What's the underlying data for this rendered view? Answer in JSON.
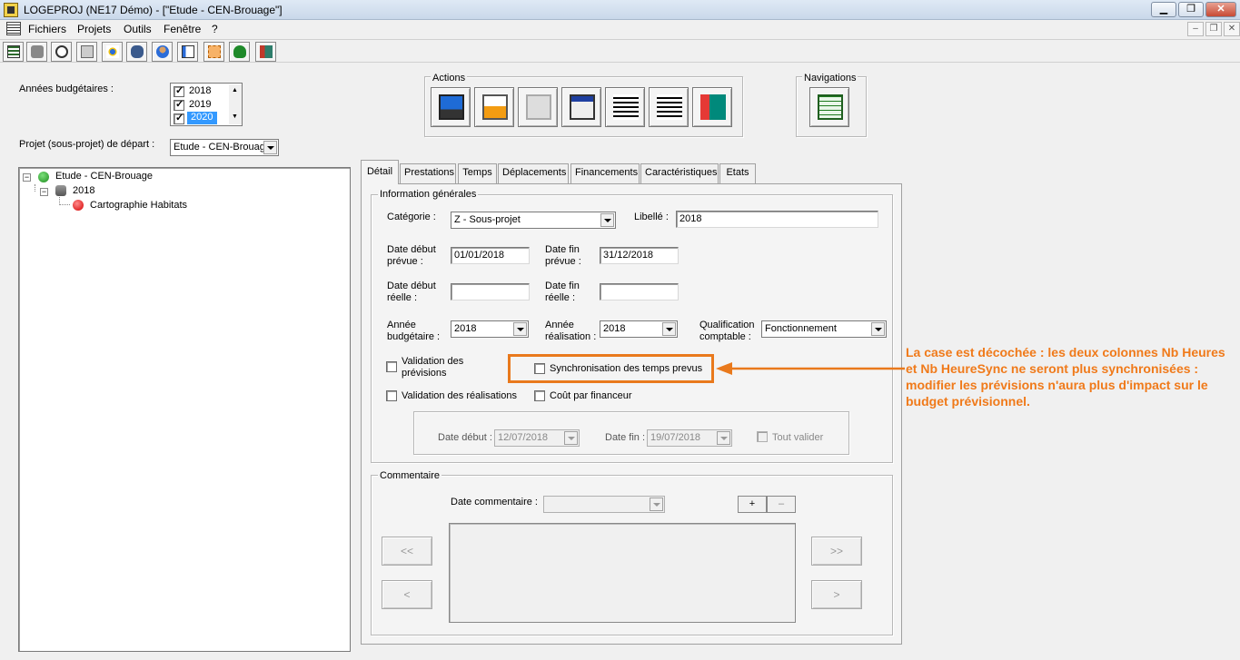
{
  "window": {
    "title": "LOGEPROJ (NE17 Démo) - [\"Etude - CEN-Brouage\"]"
  },
  "menu": {
    "items": [
      "Fichiers",
      "Projets",
      "Outils",
      "Fenêtre",
      "?"
    ]
  },
  "budget_years": {
    "label": "Années budgétaires :",
    "items": [
      {
        "label": "2018",
        "checked": true
      },
      {
        "label": "2019",
        "checked": true
      },
      {
        "label": "2020",
        "checked": true,
        "selected": true
      }
    ]
  },
  "start_project": {
    "label": "Projet (sous-projet) de départ :",
    "value": "Etude - CEN-Brouag"
  },
  "tree": {
    "root": "Etude - CEN-Brouage",
    "year": "2018",
    "leaf": "Cartographie Habitats"
  },
  "actions": {
    "title": "Actions"
  },
  "navigations": {
    "title": "Navigations"
  },
  "tabs": [
    "Détail",
    "Prestations",
    "Temps",
    "Déplacements",
    "Financements",
    "Caractéristiques",
    "Etats"
  ],
  "info": {
    "title": "Information générales",
    "categorie_label": "Catégorie :",
    "categorie_value": "Z - Sous-projet",
    "libelle_label": "Libellé :",
    "libelle_value": "2018",
    "date_debut_prevue_label1": "Date début",
    "date_debut_prevue_label2": "prévue :",
    "date_debut_prevue_value": "01/01/2018",
    "date_fin_prevue_label1": "Date fin",
    "date_fin_prevue_label2": "prévue :",
    "date_fin_prevue_value": "31/12/2018",
    "date_debut_reelle_label1": "Date début",
    "date_debut_reelle_label2": "réelle :",
    "date_debut_reelle_value": "",
    "date_fin_reelle_label1": "Date fin",
    "date_fin_reelle_label2": "réelle :",
    "date_fin_reelle_value": "",
    "annee_budgetaire_label1": "Année",
    "annee_budgetaire_label2": "budgétaire :",
    "annee_budgetaire_value": "2018",
    "annee_realisation_label1": "Année",
    "annee_realisation_label2": "réalisation :",
    "annee_realisation_value": "2018",
    "qualification_label1": "Qualification",
    "qualification_label2": "comptable :",
    "qualification_value": "Fonctionnement",
    "validation_previsions_label1": "Validation des",
    "validation_previsions_label2": "prévisions",
    "synchronisation_label": "Synchronisation des temps prevus",
    "validation_realisations_label": "Validation des réalisations",
    "cout_financeur_label": "Coût par financeur",
    "date_debut_label": "Date début :",
    "date_debut_value": "12/07/2018",
    "date_fin_label": "Date fin :",
    "date_fin_value": "19/07/2018",
    "tout_valider_label": "Tout valider"
  },
  "comment": {
    "title": "Commentaire",
    "date_label": "Date commentaire :",
    "date_value": "",
    "plus": "+",
    "minus": "–",
    "first": "<<",
    "prev": "<",
    "last": ">>",
    "next": ">"
  },
  "annotation": {
    "text": "La case est décochée : les deux colonnes Nb Heures et Nb HeureSync ne seront plus synchronisées : modifier les prévisions n'aura plus d'impact sur le budget prévisionnel."
  },
  "colors": {
    "annotation": "#e9791c",
    "selection": "#3399ff"
  }
}
